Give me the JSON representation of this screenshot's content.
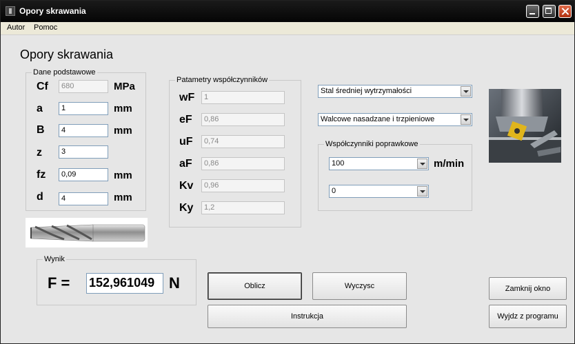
{
  "window": {
    "title": "Opory skrawania"
  },
  "menu": [
    "Autor",
    "Pomoc"
  ],
  "heading": "Opory skrawania",
  "basic": {
    "group_label": "Dane podstawowe",
    "rows": [
      {
        "label": "Cf",
        "value": "680",
        "unit": "MPa"
      },
      {
        "label": "a",
        "value": "1",
        "unit": "mm"
      },
      {
        "label": "B",
        "value": "4",
        "unit": "mm"
      },
      {
        "label": "z",
        "value": "3",
        "unit": ""
      },
      {
        "label": "fz",
        "value": "0,09",
        "unit": "mm"
      },
      {
        "label": "d",
        "value": "4",
        "unit": "mm"
      }
    ]
  },
  "coeffs": {
    "group_label": "Patametry współczynników",
    "rows": [
      {
        "label": "wF",
        "value": "1"
      },
      {
        "label": "eF",
        "value": "0,86"
      },
      {
        "label": "uF",
        "value": "0,74"
      },
      {
        "label": "aF",
        "value": "0,86"
      },
      {
        "label": "Kv",
        "value": "0,96"
      },
      {
        "label": "Ky",
        "value": "1,2"
      }
    ]
  },
  "material_select": "Stal średniej wytrzymałości",
  "cutter_select": "Walcowe nasadzane i trzpieniowe",
  "correction": {
    "group_label": "Współczynniki poprawkowe",
    "speed_value": "100",
    "speed_unit": "m/min",
    "second_value": "0"
  },
  "result": {
    "group_label": "Wynik",
    "label": "F =",
    "value": "152,961049",
    "unit": "N"
  },
  "buttons": {
    "calculate": "Oblicz",
    "clear": "Wyczysc",
    "instructions": "Instrukcja",
    "close_window": "Zamknij okno",
    "exit_program": "Wyjdz z programu"
  }
}
